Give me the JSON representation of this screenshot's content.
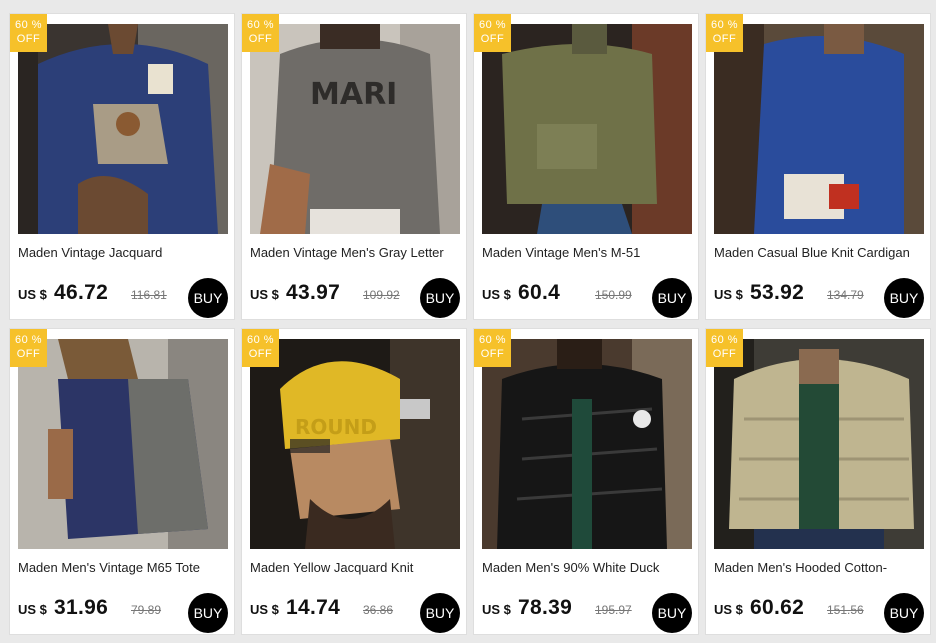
{
  "products": [
    {
      "title": "Maden Vintage Jacquard",
      "currency": "US $",
      "price": "46.72",
      "old_price": "116.81",
      "badge_pct": "60 %",
      "badge_off": "OFF",
      "buy_label": "BUY",
      "image_icon": "blue-jacquard-sweater-photo"
    },
    {
      "title": "Maden Vintage Men's Gray Letter",
      "currency": "US $",
      "price": "43.97",
      "old_price": "109.92",
      "badge_pct": "60 %",
      "badge_off": "OFF",
      "buy_label": "BUY",
      "image_icon": "gray-letter-sweater-photo"
    },
    {
      "title": "Maden Vintage Men's M-51",
      "currency": "US $",
      "price": "60.4",
      "old_price": "150.99",
      "badge_pct": "60 %",
      "badge_off": "OFF",
      "buy_label": "BUY",
      "image_icon": "olive-quilted-jacket-photo"
    },
    {
      "title": "Maden Casual Blue Knit Cardigan",
      "currency": "US $",
      "price": "53.92",
      "old_price": "134.79",
      "badge_pct": "60 %",
      "badge_off": "OFF",
      "buy_label": "BUY",
      "image_icon": "blue-knit-cardigan-photo"
    },
    {
      "title": "Maden Men's Vintage M65 Tote",
      "currency": "US $",
      "price": "31.96",
      "old_price": "79.89",
      "badge_pct": "60 %",
      "badge_off": "OFF",
      "buy_label": "BUY",
      "image_icon": "tote-bag-photo"
    },
    {
      "title": "Maden Yellow Jacquard Knit",
      "currency": "US $",
      "price": "14.74",
      "old_price": "36.86",
      "badge_pct": "60 %",
      "badge_off": "OFF",
      "buy_label": "BUY",
      "image_icon": "yellow-beanie-photo"
    },
    {
      "title": "Maden Men's 90% White Duck",
      "currency": "US $",
      "price": "78.39",
      "old_price": "195.97",
      "badge_pct": "60 %",
      "badge_off": "OFF",
      "buy_label": "BUY",
      "image_icon": "black-down-jacket-photo"
    },
    {
      "title": "Maden Men's Hooded Cotton-",
      "currency": "US $",
      "price": "60.62",
      "old_price": "151.56",
      "badge_pct": "60 %",
      "badge_off": "OFF",
      "buy_label": "BUY",
      "image_icon": "khaki-puffer-jacket-photo"
    }
  ],
  "colors": {
    "badge": "#f6c12a",
    "buy_button": "#000000",
    "background": "#e9e9e9"
  }
}
